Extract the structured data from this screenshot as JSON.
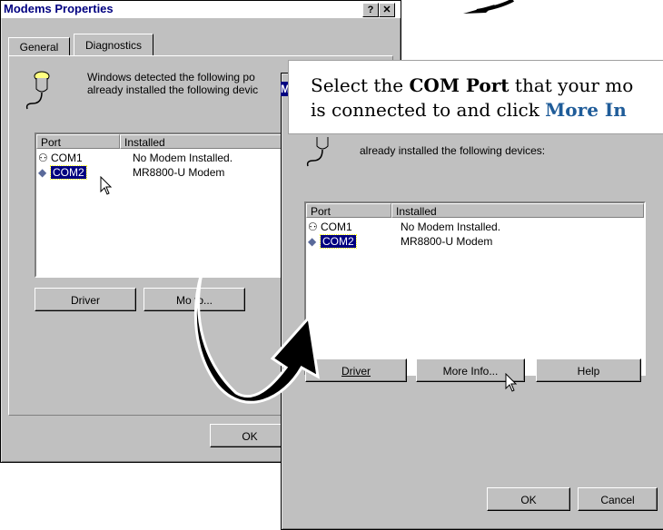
{
  "back": {
    "title": "Modems Properties",
    "help_glyph": "?",
    "close_glyph": "✕",
    "tabs": [
      "General",
      "Diagnostics"
    ],
    "info_line1": "Windows detected the following po",
    "info_line2": "already installed the following devic",
    "col_port": "Port",
    "col_installed": "Installed",
    "rows": [
      {
        "port": "COM1",
        "installed": "No Modem Installed."
      },
      {
        "port": "COM2",
        "installed": "MR8800-U Modem"
      }
    ],
    "driver": "Driver",
    "more_info": "Mo     fo...",
    "ok": "OK"
  },
  "front": {
    "title_tail": "M",
    "info_line2": "already installed the following devices:",
    "col_port": "Port",
    "col_installed": "Installed",
    "rows": [
      {
        "port": "COM1",
        "installed": "No Modem Installed."
      },
      {
        "port": "COM2",
        "installed": "MR8800-U Modem"
      }
    ],
    "driver": "Driver",
    "more_info": "More Info...",
    "help": "Help",
    "ok": "OK",
    "cancel": "Cancel"
  },
  "callout": {
    "l1_a": "Select the ",
    "l1_b": "COM Port",
    "l1_c": " that your mo",
    "l2_a": "is connected to and click ",
    "l2_b": "More In"
  },
  "colors": {
    "selection": "#000080",
    "accent": "#1f5c99",
    "face": "#c0c0c0"
  }
}
